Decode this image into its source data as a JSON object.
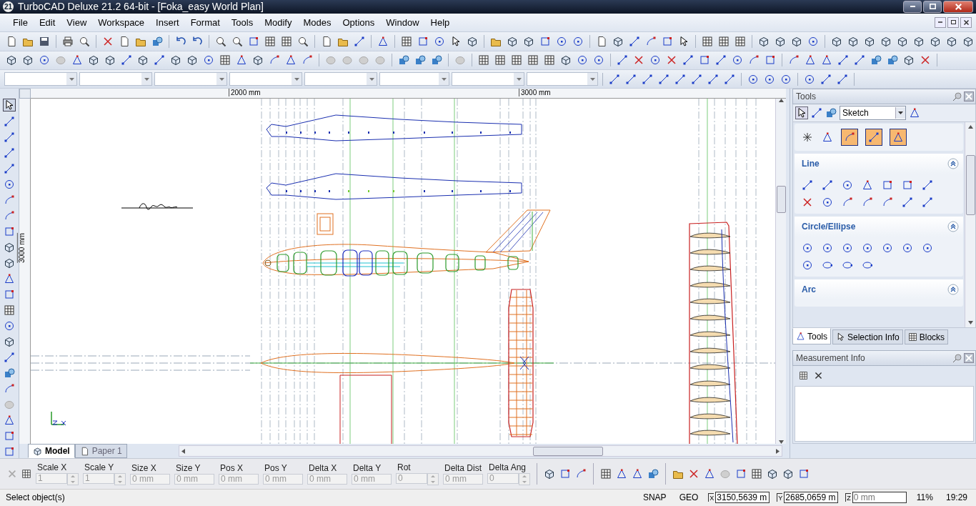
{
  "title_bar": {
    "app_badge": "21",
    "title": "TurboCAD Deluxe 21.2 64-bit - [Foka_easy World Plan]"
  },
  "menu": [
    {
      "label": "File"
    },
    {
      "label": "Edit"
    },
    {
      "label": "View"
    },
    {
      "label": "Workspace"
    },
    {
      "label": "Insert"
    },
    {
      "label": "Format"
    },
    {
      "label": "Tools"
    },
    {
      "label": "Modify"
    },
    {
      "label": "Modes"
    },
    {
      "label": "Options"
    },
    {
      "label": "Window"
    },
    {
      "label": "Help"
    }
  ],
  "canvas": {
    "ruler_x_labels": [
      "2000 mm",
      "3000 mm"
    ],
    "ruler_y_label": "3000 mm"
  },
  "sheet_tabs": [
    {
      "label": "Model",
      "selected": true
    },
    {
      "label": "Paper 1",
      "selected": false
    }
  ],
  "tools_panel": {
    "title": "Tools",
    "mode": "Sketch",
    "sections": [
      {
        "title": "Line",
        "expanded": true
      },
      {
        "title": "Circle/Ellipse",
        "expanded": true
      },
      {
        "title": "Arc",
        "expanded": true
      }
    ],
    "tabs": [
      {
        "label": "Tools",
        "selected": true
      },
      {
        "label": "Selection Info",
        "selected": false
      },
      {
        "label": "Blocks",
        "selected": false
      }
    ]
  },
  "measurement_panel": {
    "title": "Measurement Info"
  },
  "inspector": {
    "fields": [
      {
        "label": "Scale X",
        "value": "1",
        "kind": "spin",
        "disabled": true
      },
      {
        "label": "Scale Y",
        "value": "1",
        "kind": "spin",
        "disabled": true
      },
      {
        "label": "Size X",
        "value": "0 mm",
        "kind": "plain",
        "disabled": true
      },
      {
        "label": "Size Y",
        "value": "0 mm",
        "kind": "plain",
        "disabled": true
      },
      {
        "label": "Pos X",
        "value": "0 mm",
        "kind": "plain",
        "disabled": true
      },
      {
        "label": "Pos Y",
        "value": "0 mm",
        "kind": "plain",
        "disabled": true
      },
      {
        "label": "Delta X",
        "value": "0 mm",
        "kind": "plain",
        "disabled": true
      },
      {
        "label": "Delta Y",
        "value": "0 mm",
        "kind": "plain",
        "disabled": true
      },
      {
        "label": "Rot",
        "value": "0",
        "kind": "spin",
        "disabled": true
      },
      {
        "label": "Delta Dist",
        "value": "0 mm",
        "kind": "plain",
        "disabled": true
      },
      {
        "label": "Delta Ang",
        "value": "0",
        "kind": "spin",
        "disabled": true
      }
    ]
  },
  "status_bar": {
    "message": "Select object(s)",
    "snap": "SNAP",
    "geo": "GEO",
    "coords": [
      {
        "axis": "X",
        "value": "3150,5639 m"
      },
      {
        "axis": "Y",
        "value": "2685,0659 m"
      },
      {
        "axis": "Z",
        "placeholder": "0 mm"
      }
    ],
    "zoom": "11%",
    "time": "19:29"
  }
}
